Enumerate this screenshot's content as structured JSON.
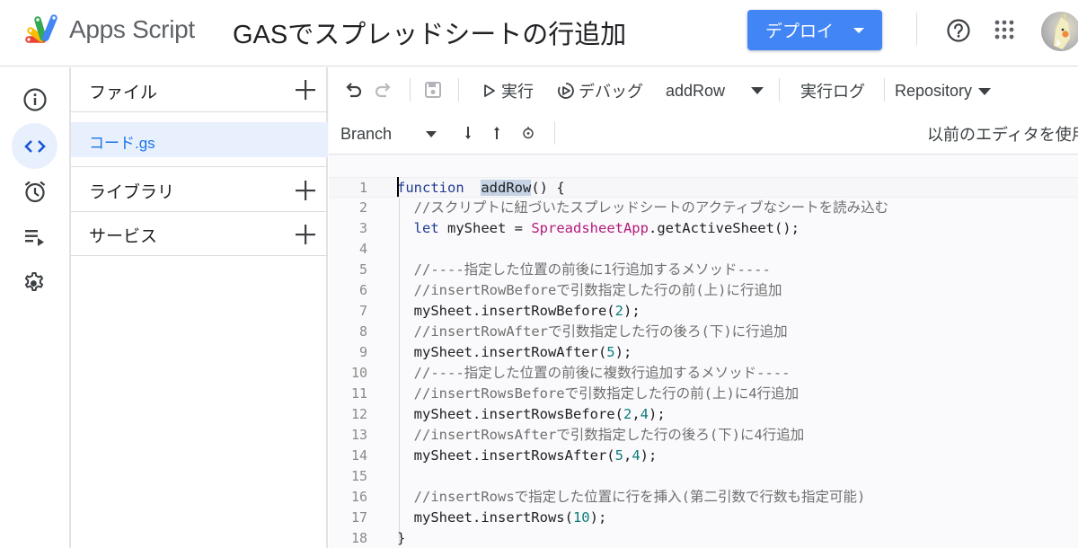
{
  "header": {
    "app_name": "Apps Script",
    "project_title": "GASでスプレッドシートの行追加",
    "deploy_label": "デプロイ",
    "icons": [
      "apps-script-logo",
      "help-icon",
      "apps-grid-icon",
      "avatar"
    ]
  },
  "rail": {
    "items": [
      {
        "name": "overview",
        "icon": "info-icon",
        "active": false
      },
      {
        "name": "editor",
        "icon": "code-icon",
        "active": true
      },
      {
        "name": "triggers",
        "icon": "alarm-icon",
        "active": false
      },
      {
        "name": "executions",
        "icon": "playlist-play-icon",
        "active": false
      },
      {
        "name": "settings",
        "icon": "gear-icon",
        "active": false
      }
    ]
  },
  "files_panel": {
    "files_title": "ファイル",
    "files": [
      {
        "name": "コード.gs",
        "selected": true
      }
    ],
    "libraries_title": "ライブラリ",
    "services_title": "サービス"
  },
  "toolbar": {
    "run_label": "実行",
    "debug_label": "デバッグ",
    "function_select": "addRow",
    "exec_log_label": "実行ログ",
    "repository_label": "Repository",
    "branch_label": "Branch",
    "legacy_editor_label": "以前のエディタを使用"
  },
  "editor": {
    "lines": [
      {
        "n": "1",
        "tokens": [
          [
            "kw",
            "function"
          ],
          [
            "",
            "  "
          ],
          [
            "fnhl",
            "addRow"
          ],
          [
            "",
            "() {"
          ]
        ]
      },
      {
        "n": "2",
        "tokens": [
          [
            "",
            "  "
          ],
          [
            "cmt",
            "//スクリプトに紐づいたスプレッドシートのアクティブなシートを読み込む"
          ]
        ]
      },
      {
        "n": "3",
        "tokens": [
          [
            "",
            "  "
          ],
          [
            "kw",
            "let"
          ],
          [
            "",
            " mySheet = "
          ],
          [
            "cls",
            "SpreadsheetApp"
          ],
          [
            "",
            ".getActiveSheet();"
          ]
        ]
      },
      {
        "n": "4",
        "tokens": []
      },
      {
        "n": "5",
        "tokens": [
          [
            "",
            "  "
          ],
          [
            "cmt",
            "//----指定した位置の前後に1行追加するメソッド----"
          ]
        ]
      },
      {
        "n": "6",
        "tokens": [
          [
            "",
            "  "
          ],
          [
            "cmt",
            "//insertRowBeforeで引数指定した行の前(上)に行追加"
          ]
        ]
      },
      {
        "n": "7",
        "tokens": [
          [
            "",
            "  mySheet.insertRowBefore("
          ],
          [
            "num",
            "2"
          ],
          [
            "",
            ");"
          ]
        ]
      },
      {
        "n": "8",
        "tokens": [
          [
            "",
            "  "
          ],
          [
            "cmt",
            "//insertRowAfterで引数指定した行の後ろ(下)に行追加"
          ]
        ]
      },
      {
        "n": "9",
        "tokens": [
          [
            "",
            "  mySheet.insertRowAfter("
          ],
          [
            "num",
            "5"
          ],
          [
            "",
            ");"
          ]
        ]
      },
      {
        "n": "10",
        "tokens": [
          [
            "",
            "  "
          ],
          [
            "cmt",
            "//----指定した位置の前後に複数行追加するメソッド----"
          ]
        ]
      },
      {
        "n": "11",
        "tokens": [
          [
            "",
            "  "
          ],
          [
            "cmt",
            "//insertRowsBeforeで引数指定した行の前(上)に4行追加"
          ]
        ]
      },
      {
        "n": "12",
        "tokens": [
          [
            "",
            "  mySheet.insertRowsBefore("
          ],
          [
            "num",
            "2"
          ],
          [
            "",
            ","
          ],
          [
            "num",
            "4"
          ],
          [
            "",
            ");"
          ]
        ]
      },
      {
        "n": "13",
        "tokens": [
          [
            "",
            "  "
          ],
          [
            "cmt",
            "//insertRowsAfterで引数指定した行の後ろ(下)に4行追加"
          ]
        ]
      },
      {
        "n": "14",
        "tokens": [
          [
            "",
            "  mySheet.insertRowsAfter("
          ],
          [
            "num",
            "5"
          ],
          [
            "",
            ","
          ],
          [
            "num",
            "4"
          ],
          [
            "",
            ");"
          ]
        ]
      },
      {
        "n": "15",
        "tokens": []
      },
      {
        "n": "16",
        "tokens": [
          [
            "",
            "  "
          ],
          [
            "cmt",
            "//insertRowsで指定した位置に行を挿入(第二引数で行数も指定可能)"
          ]
        ]
      },
      {
        "n": "17",
        "tokens": [
          [
            "",
            "  mySheet.insertRows("
          ],
          [
            "num",
            "10"
          ],
          [
            "",
            ");"
          ]
        ]
      },
      {
        "n": "18",
        "tokens": [
          [
            "",
            "}"
          ]
        ]
      }
    ]
  },
  "colors": {
    "accent": "#4285f4",
    "selected_bg": "#e8f0fe",
    "selected_text": "#1a73e8",
    "keyword": "#1f3a93",
    "class": "#b5197a",
    "number": "#0e7c7b",
    "comment": "#6f6f6f"
  }
}
